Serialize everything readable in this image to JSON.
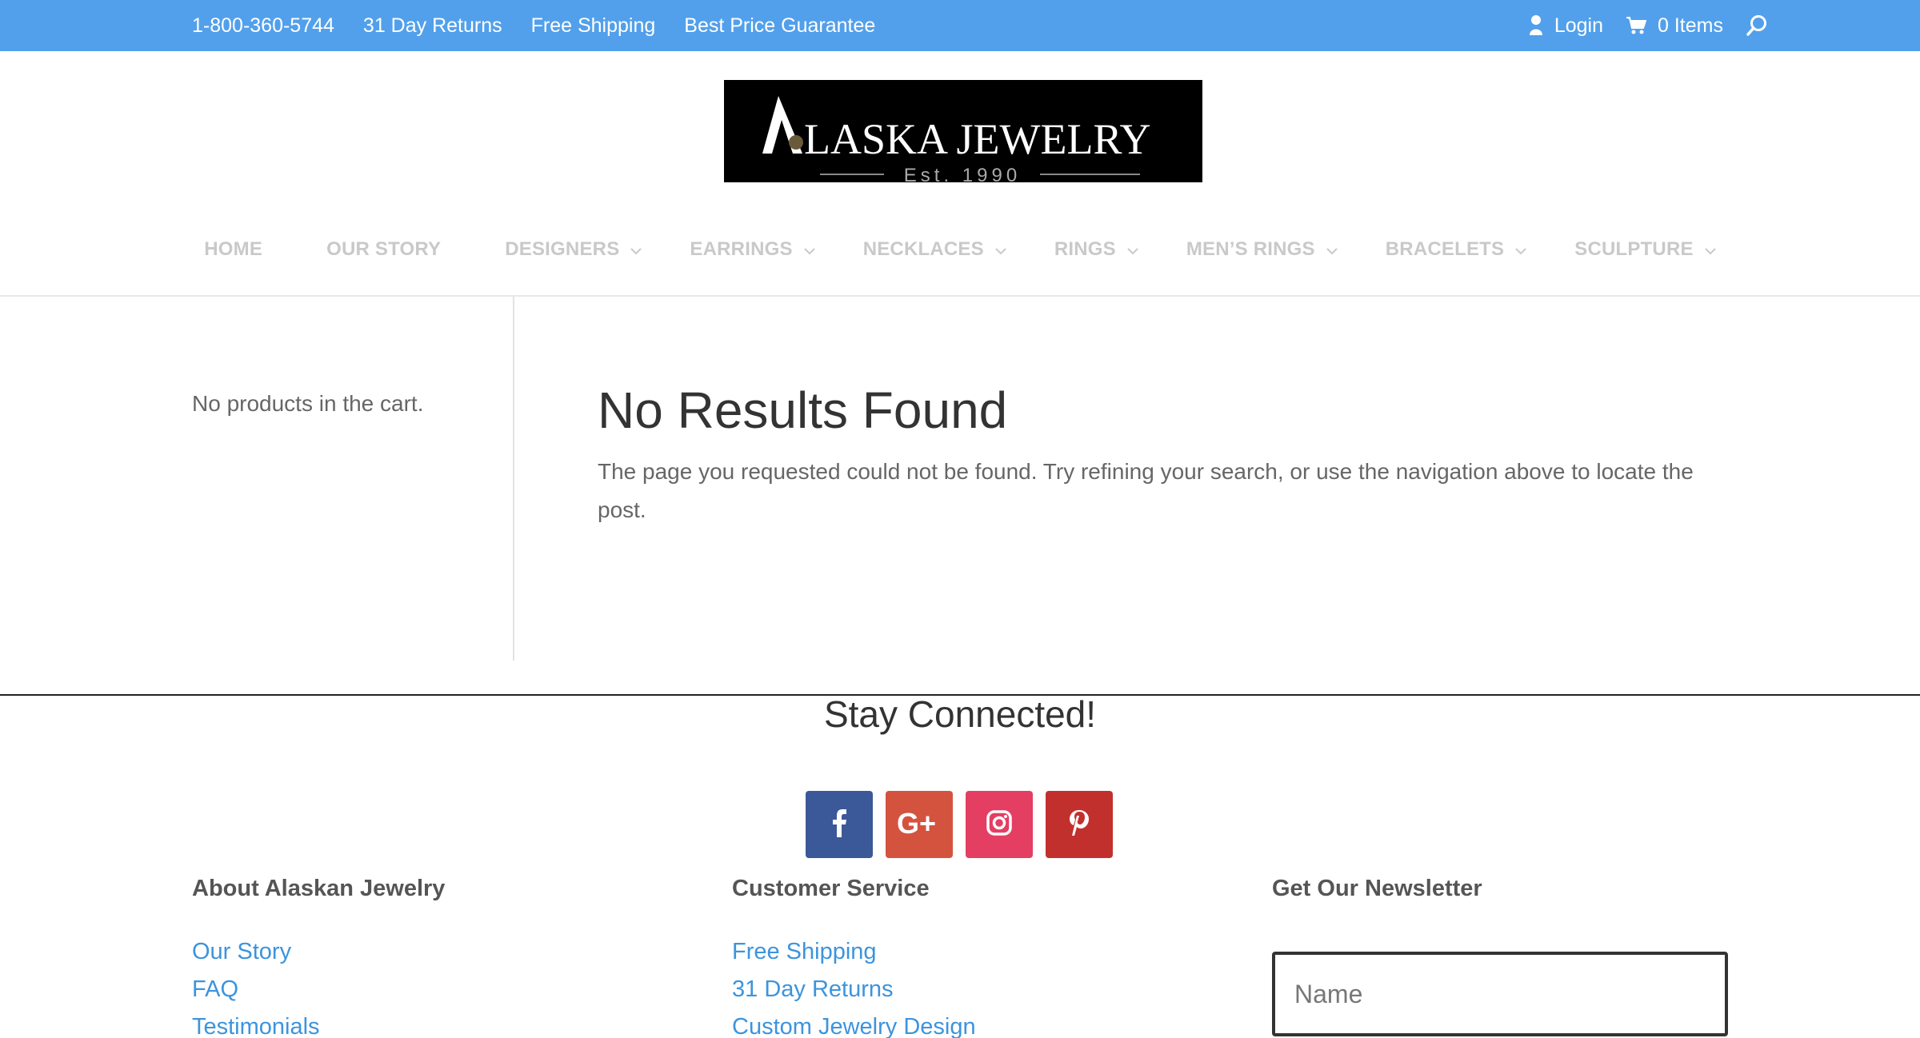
{
  "topbar": {
    "left_links": [
      "1-800-360-5744",
      "31 Day Returns",
      "Free Shipping",
      "Best Price Guarantee"
    ],
    "login_label": "Login",
    "cart_label": "0 Items"
  },
  "logo": {
    "text": "ALASKA JEWELRY",
    "sub": "Est. 1990"
  },
  "nav": {
    "items": [
      {
        "label": "HOME",
        "has_dropdown": false
      },
      {
        "label": "OUR STORY",
        "has_dropdown": false
      },
      {
        "label": "DESIGNERS",
        "has_dropdown": true
      },
      {
        "label": "EARRINGS",
        "has_dropdown": true
      },
      {
        "label": "NECKLACES",
        "has_dropdown": true
      },
      {
        "label": "RINGS",
        "has_dropdown": true
      },
      {
        "label": "MEN’S RINGS",
        "has_dropdown": true
      },
      {
        "label": "BRACELETS",
        "has_dropdown": true
      },
      {
        "label": "SCULPTURE",
        "has_dropdown": true
      }
    ]
  },
  "sidebar": {
    "cart_text": "No products in the cart."
  },
  "main": {
    "title": "No Results Found",
    "text": "The page you requested could not be found. Try refining your search, or use the navigation above to locate the post."
  },
  "footer": {
    "stay_connected": "Stay Connected!",
    "social": [
      {
        "name": "facebook",
        "color": "#3b5998"
      },
      {
        "name": "google-plus",
        "color": "#dd4b39"
      },
      {
        "name": "instagram",
        "color": "#ea2c59"
      },
      {
        "name": "pinterest",
        "color": "#cb2027"
      }
    ],
    "columns": [
      {
        "title": "About Alaskan Jewelry",
        "links": [
          "Our Story",
          "FAQ",
          "Testimonials"
        ]
      },
      {
        "title": "Customer Service",
        "links": [
          "Free Shipping",
          "31 Day Returns",
          "Custom Jewelry Design"
        ]
      },
      {
        "title": "Get Our Newsletter",
        "links": []
      }
    ],
    "newsletter_name_placeholder": "Name"
  },
  "colors": {
    "topbar": "#52a0eb",
    "link": "#3c94de",
    "nav_text": "#c9c9c9"
  }
}
